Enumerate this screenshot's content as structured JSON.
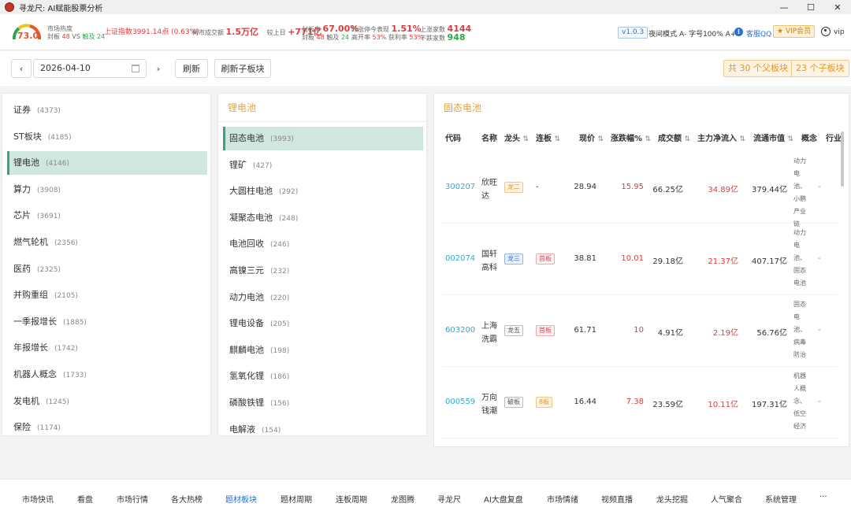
{
  "window": {
    "title": "寻龙尺: AI赋能股票分析",
    "minimize": "—",
    "maximize": "☐",
    "close": "✕"
  },
  "header": {
    "gauge_value": "73.0",
    "market_heat_label": "市场热度",
    "seal_label": "封板",
    "seal_count": "48",
    "vs": "VS",
    "break_label": "触及",
    "break_count": "24",
    "sh_index": "上证指数3991.14点 (0.63%)",
    "turnover_label": "两市成交额",
    "turnover_value": "1.5万亿",
    "vs_prev_label": "较上日",
    "vs_prev_value": "+771亿",
    "seal_rate_label": "封板率",
    "seal_rate_value": "67.00%",
    "seal2_label": "封板",
    "seal2_count": "48",
    "break2_label": "触及",
    "break2_count": "24",
    "yesterday_label": "昨涨停今表现",
    "yesterday_value": "1.51%",
    "open_rate_label": "高开率",
    "open_rate_value": "53%",
    "profit_rate_label": "获利率",
    "profit_rate_value": "53%",
    "up_label": "上涨家数",
    "up_value": "4144",
    "down_label": "下跌家数",
    "down_value": "948",
    "version": "v1.0.3",
    "night_mode": "夜间模式",
    "font_size": "A-  字号100%  A+",
    "service": "客服QQ",
    "vip_button": "VIP会员",
    "user": "vip"
  },
  "toolbar": {
    "date": "2026-04-10",
    "refresh": "刷新",
    "refresh_sub": "刷新子板块",
    "parent_count": "共 30 个父板块",
    "child_count": "23 个子板块"
  },
  "sectors": [
    {
      "label": "证券",
      "count": "(4373)"
    },
    {
      "label": "ST板块",
      "count": "(4185)"
    },
    {
      "label": "锂电池",
      "count": "(4146)"
    },
    {
      "label": "算力",
      "count": "(3908)"
    },
    {
      "label": "芯片",
      "count": "(3691)"
    },
    {
      "label": "燃气轮机",
      "count": "(2356)"
    },
    {
      "label": "医药",
      "count": "(2325)"
    },
    {
      "label": "并购重组",
      "count": "(2105)"
    },
    {
      "label": "一季报增长",
      "count": "(1885)"
    },
    {
      "label": "年报增长",
      "count": "(1742)"
    },
    {
      "label": "机器人概念",
      "count": "(1733)"
    },
    {
      "label": "发电机",
      "count": "(1245)"
    },
    {
      "label": "保险",
      "count": "(1174)"
    }
  ],
  "sub_panel": {
    "title": "锂电池",
    "items": [
      {
        "label": "固态电池",
        "count": "(3993)"
      },
      {
        "label": "锂矿",
        "count": "(427)"
      },
      {
        "label": "大圆柱电池",
        "count": "(292)"
      },
      {
        "label": "凝聚态电池",
        "count": "(248)"
      },
      {
        "label": "电池回收",
        "count": "(246)"
      },
      {
        "label": "高镍三元",
        "count": "(232)"
      },
      {
        "label": "动力电池",
        "count": "(220)"
      },
      {
        "label": "锂电设备",
        "count": "(205)"
      },
      {
        "label": "麒麟电池",
        "count": "(198)"
      },
      {
        "label": "氢氧化锂",
        "count": "(186)"
      },
      {
        "label": "磷酸铁锂",
        "count": "(156)"
      },
      {
        "label": "电解液",
        "count": "(154)"
      }
    ]
  },
  "stock_panel": {
    "title": "固态电池",
    "columns": {
      "code": "代码",
      "name": "名称",
      "leader": "龙头",
      "streak": "连板",
      "price": "现价",
      "change": "涨跌幅%",
      "volume": "成交额",
      "inflow": "主力净流入",
      "mcap": "流通市值",
      "concept": "概念",
      "industry": "行业"
    },
    "rows": [
      {
        "code": "300207",
        "name": "欣旺达",
        "leader": "龙二",
        "streak": "-",
        "price": "28.94",
        "change": "15.95",
        "volume": "66.25亿",
        "inflow": "34.89亿",
        "mcap": "379.44亿",
        "concept": "动力电池、小鹏产业链",
        "industry": "-"
      },
      {
        "code": "002074",
        "name": "国轩高科",
        "leader": "龙三",
        "streak": "首板",
        "price": "38.81",
        "change": "10.01",
        "volume": "29.18亿",
        "inflow": "21.37亿",
        "mcap": "407.17亿",
        "concept": "动力电池、固态电池",
        "industry": "-"
      },
      {
        "code": "603200",
        "name": "上海洗霸",
        "leader": "龙五",
        "streak": "首板",
        "price": "61.71",
        "change": "10",
        "volume": "4.91亿",
        "inflow": "2.19亿",
        "mcap": "56.76亿",
        "concept": "固态电池、病毒防治",
        "industry": "-"
      },
      {
        "code": "000559",
        "name": "万向钱潮",
        "leader": "破板",
        "streak": "8板",
        "price": "16.44",
        "change": "7.38",
        "volume": "23.59亿",
        "inflow": "10.11亿",
        "mcap": "197.31亿",
        "concept": "机器人概念、低空经济",
        "industry": "-"
      }
    ]
  },
  "bottom_nav": [
    "市场快讯",
    "看盘",
    "市场行情",
    "各大热榜",
    "题材板块",
    "题材周期",
    "连板周期",
    "龙图腾",
    "寻龙尺",
    "AI大盘复盘",
    "市场情绪",
    "视频直播",
    "龙头挖掘",
    "人气聚合",
    "系统管理",
    "···"
  ],
  "bottom_nav_active": "题材板块"
}
